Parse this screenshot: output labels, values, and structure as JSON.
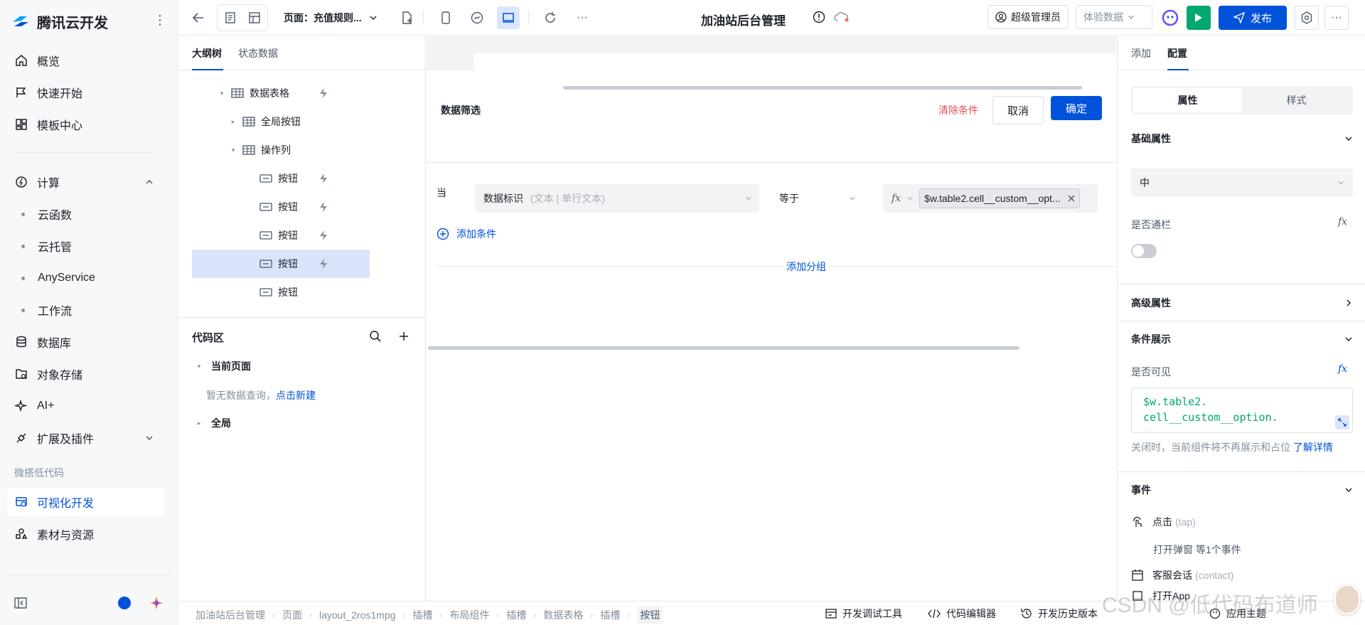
{
  "brand": {
    "name": "腾讯云开发"
  },
  "nav": {
    "items": [
      {
        "label": "概览",
        "icon": "home-icon"
      },
      {
        "label": "快速开始",
        "icon": "flag-icon"
      },
      {
        "label": "模板中心",
        "icon": "grid-icon"
      }
    ],
    "compute": {
      "label": "计算",
      "icon": "hexagon-icon"
    },
    "compute_sub": [
      {
        "label": "云函数"
      },
      {
        "label": "云托管"
      },
      {
        "label": "AnyService"
      },
      {
        "label": "工作流"
      }
    ],
    "more": [
      {
        "label": "数据库",
        "icon": "database-icon"
      },
      {
        "label": "对象存储",
        "icon": "storage-icon"
      },
      {
        "label": "AI+",
        "icon": "sparkle-icon"
      },
      {
        "label": "扩展及插件",
        "icon": "plugin-icon"
      }
    ],
    "group_label": "微搭低代码",
    "lowcode": [
      {
        "label": "可视化开发",
        "icon": "visual-dev-icon"
      },
      {
        "label": "素材与资源",
        "icon": "assets-icon"
      }
    ]
  },
  "topbar": {
    "page_selector": "页面：充值规则...",
    "app_title": "加油站后台管理",
    "role": "超级管理员",
    "data_mode": "体验数据",
    "publish": "发布",
    "more": "···"
  },
  "outline": {
    "tabs": [
      "大纲树",
      "状态数据"
    ],
    "tree": [
      {
        "label": "数据表格",
        "indent": 0,
        "caret": "▾",
        "icon": "table-icon",
        "bolt": true
      },
      {
        "label": "全局按钮",
        "indent": 1,
        "caret": "▸",
        "icon": "table-icon",
        "bolt": false
      },
      {
        "label": "操作列",
        "indent": 1,
        "caret": "▾",
        "icon": "table-icon",
        "bolt": false
      },
      {
        "label": "按钮",
        "indent": 2,
        "caret": "",
        "icon": "button-icon",
        "bolt": true
      },
      {
        "label": "按钮",
        "indent": 2,
        "caret": "",
        "icon": "button-icon",
        "bolt": true
      },
      {
        "label": "按钮",
        "indent": 2,
        "caret": "",
        "icon": "button-icon",
        "bolt": true
      },
      {
        "label": "按钮",
        "indent": 2,
        "caret": "",
        "icon": "button-icon",
        "bolt": true,
        "selected": true
      },
      {
        "label": "按钮",
        "indent": 2,
        "caret": "",
        "icon": "button-icon",
        "bolt": false
      }
    ],
    "code_area": {
      "title": "代码区",
      "current_page": "当前页面",
      "empty_text": "暂无数据查询，",
      "create_link": "点击新建",
      "global": "全局"
    }
  },
  "filter": {
    "title": "数据筛选",
    "clear": "清除条件",
    "cancel": "取消",
    "confirm": "确定",
    "when": "当",
    "field": "数据标识",
    "field_hint": "(文本 | 单行文本)",
    "operator": "等于",
    "fx": "fx",
    "value": "$w.table2.cell__custom__opt...",
    "add_condition": "添加条件",
    "add_group": "添加分组"
  },
  "right": {
    "tabs": [
      "添加",
      "配置"
    ],
    "segment": [
      "属性",
      "样式"
    ],
    "basic": {
      "title": "基础属性",
      "size_value": "中",
      "banner_label": "是否通栏",
      "banner_on": false
    },
    "advanced": {
      "title": "高级属性"
    },
    "conditional": {
      "title": "条件展示",
      "visible_label": "是否可见",
      "expr_line1": "$w.table2.",
      "expr_line2": "cell__custom__option.",
      "hint": "关闭时，当前组件将不再展示和占位",
      "learn_more": "了解详情"
    },
    "events": {
      "title": "事件",
      "items": [
        {
          "label": "点击",
          "key": "(tap)",
          "icon": "tap-icon"
        },
        {
          "sub": "打开弹窗 等1个事件"
        },
        {
          "label": "客服会话",
          "key": "(contact)",
          "icon": "calendar-icon"
        },
        {
          "label": "打开App",
          "key": "",
          "icon": "app-icon"
        }
      ]
    }
  },
  "bottombar": {
    "breadcrumb": [
      "加油站后台管理",
      "页面",
      "layout_2ros1mpg",
      "插槽",
      "布局组件",
      "插槽",
      "数据表格",
      "插槽",
      "按钮"
    ],
    "tools": [
      "开发调试工具",
      "代码编辑器",
      "开发历史版本",
      "应用主题"
    ]
  },
  "watermark": "CSDN @低代码布道师",
  "colors": {
    "primary": "#0052d9",
    "danger": "#e34d59",
    "success": "#00a870"
  }
}
